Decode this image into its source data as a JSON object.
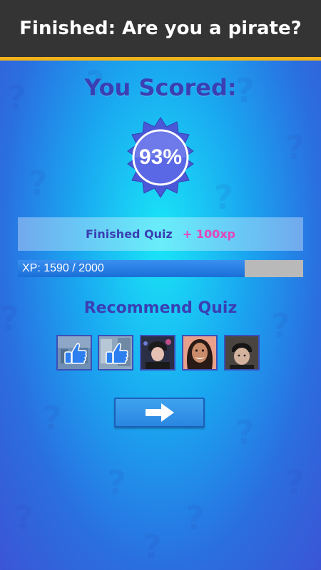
{
  "header": {
    "title": "Finished: Are you a pirate?"
  },
  "result": {
    "scored_title": "You Scored:",
    "score_text": "93%"
  },
  "reward": {
    "label": "Finished Quiz",
    "xp_gain": "+ 100xp"
  },
  "xp": {
    "text": "XP: 1590 / 2000",
    "current": 1590,
    "max": 2000
  },
  "recommend": {
    "title": "Recommend Quiz",
    "items": [
      {
        "icon": "thumbs-up-icon"
      },
      {
        "icon": "thumbs-up-icon"
      },
      {
        "icon": "person-photo"
      },
      {
        "icon": "person-photo"
      },
      {
        "icon": "person-photo"
      }
    ]
  },
  "next_button": {
    "icon": "arrow-right-icon"
  },
  "colors": {
    "header_bg": "#343434",
    "header_border": "#f2b31a",
    "title_text": "#3a3fb3",
    "xp_gain": "#e546b8",
    "badge": "#4a58d8"
  }
}
